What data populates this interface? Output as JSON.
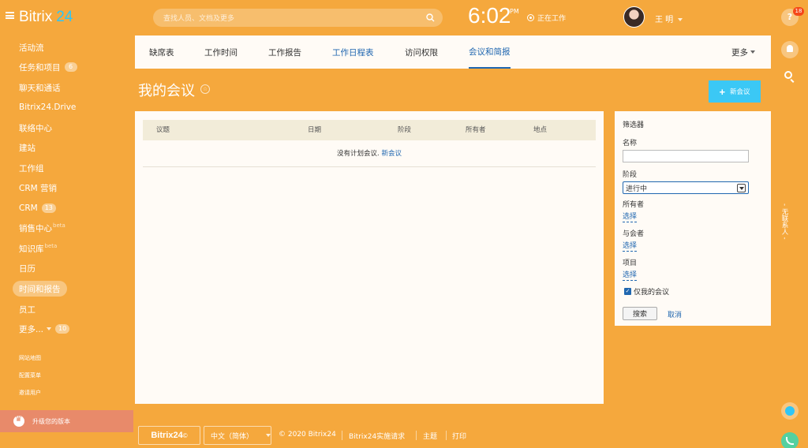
{
  "header": {
    "logo_text": "Bitrix",
    "logo_number": "24",
    "search_placeholder": "查找人员、文档及更多",
    "clock": "6:02",
    "ampm": "PM",
    "work_status": "正在工作",
    "username": "王 明"
  },
  "sidebar": {
    "items": [
      {
        "label": "活动流"
      },
      {
        "label": "任务和项目",
        "badge": "6"
      },
      {
        "label": "聊天和通话"
      },
      {
        "label": "Bitrix24.Drive"
      },
      {
        "label": "联络中心"
      },
      {
        "label": "建站"
      },
      {
        "label": "工作组"
      },
      {
        "label": "CRM 营销"
      },
      {
        "label": "CRM",
        "badge": "13"
      },
      {
        "label": "销售中心",
        "sup": "beta"
      },
      {
        "label": "知识库",
        "sup": "beta"
      },
      {
        "label": "日历"
      },
      {
        "label": "时间和报告"
      },
      {
        "label": "员工"
      },
      {
        "label": "更多...",
        "badge": "10"
      }
    ],
    "small_links": [
      "网站地图",
      "配置菜单",
      "邀请用户"
    ],
    "upgrade_label": "升级您的版本"
  },
  "tabs": [
    "缺席表",
    "工作时间",
    "工作报告",
    "工作日程表",
    "访问权限",
    "会议和简报"
  ],
  "more_tab": "更多",
  "page": {
    "title": "我的会议",
    "new_button": "新会议"
  },
  "table": {
    "columns": [
      "议题",
      "日期",
      "阶段",
      "所有者",
      "地点"
    ],
    "empty_text": "没有计划会议.",
    "empty_link": "新会议"
  },
  "filter": {
    "title": "筛选器",
    "name_label": "名称",
    "name_value": "",
    "stage_label": "阶段",
    "stage_value": "进行中",
    "owner_label": "所有者",
    "select_link": "选择",
    "participants_label": "与会者",
    "project_label": "项目",
    "only_mine_label": "仅我的会议",
    "only_mine_checked": true,
    "search_button": "搜索",
    "cancel_link": "取消"
  },
  "right": {
    "help_badge": "18",
    "contact_label": "无联系人"
  },
  "footer": {
    "logo": "Bitrix24",
    "language": "中文（简体）",
    "copyright": "© 2020 Bitrix24",
    "impl_request": "Bitrix24实施请求",
    "theme": "主题",
    "print": "打印"
  },
  "colors": {
    "theme_orange": "#f5a83d",
    "link_blue": "#2067b0",
    "button_cyan": "#3bc8f5"
  }
}
